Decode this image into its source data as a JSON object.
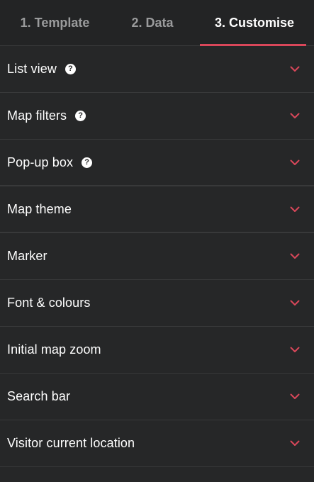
{
  "tabs": [
    {
      "label": "1. Template",
      "active": false
    },
    {
      "label": "2. Data",
      "active": false
    },
    {
      "label": "3. Customise",
      "active": true
    }
  ],
  "sections": [
    {
      "label": "List view",
      "help_icon": "question-icon",
      "help_text": "?"
    },
    {
      "label": "Map filters",
      "help_icon": "question-icon",
      "help_text": "?"
    },
    {
      "label": "Pop-up box",
      "help_icon": "question-icon",
      "help_text": "?"
    },
    {
      "label": "Map theme"
    },
    {
      "label": "Marker"
    },
    {
      "label": "Font & colours"
    },
    {
      "label": "Initial map zoom"
    },
    {
      "label": "Search bar"
    },
    {
      "label": "Visitor current location"
    }
  ],
  "colors": {
    "background": "#262728",
    "accent": "#d9475a",
    "text": "#ffffff",
    "inactive_tab": "#9a9b9c"
  },
  "icons": {
    "expand": "chevron-down-icon"
  }
}
